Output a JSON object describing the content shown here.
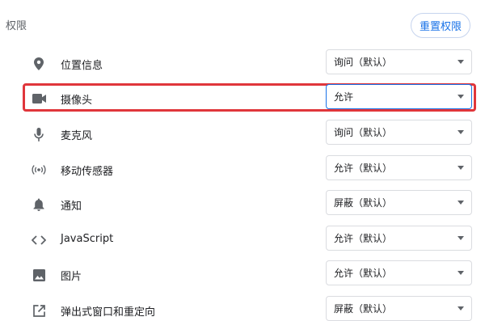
{
  "section": {
    "title": "权限",
    "reset_label": "重置权限"
  },
  "permissions": [
    {
      "icon": "location-pin-icon",
      "label": "位置信息",
      "value": "询问（默认）"
    },
    {
      "icon": "camera-icon",
      "label": "摄像头",
      "value": "允许"
    },
    {
      "icon": "microphone-icon",
      "label": "麦克风",
      "value": "询问（默认）"
    },
    {
      "icon": "motion-sensor-icon",
      "label": "移动传感器",
      "value": "允许（默认）"
    },
    {
      "icon": "bell-icon",
      "label": "通知",
      "value": "屏蔽（默认）"
    },
    {
      "icon": "code-icon",
      "label": "JavaScript",
      "value": "允许（默认）"
    },
    {
      "icon": "image-icon",
      "label": "图片",
      "value": "允许（默认）"
    },
    {
      "icon": "open-in-new-icon",
      "label": "弹出式窗口和重定向",
      "value": "屏蔽（默认）"
    }
  ],
  "colors": {
    "accent": "#1a73e8",
    "highlight": "#e0363b",
    "icon": "#5f6368"
  }
}
